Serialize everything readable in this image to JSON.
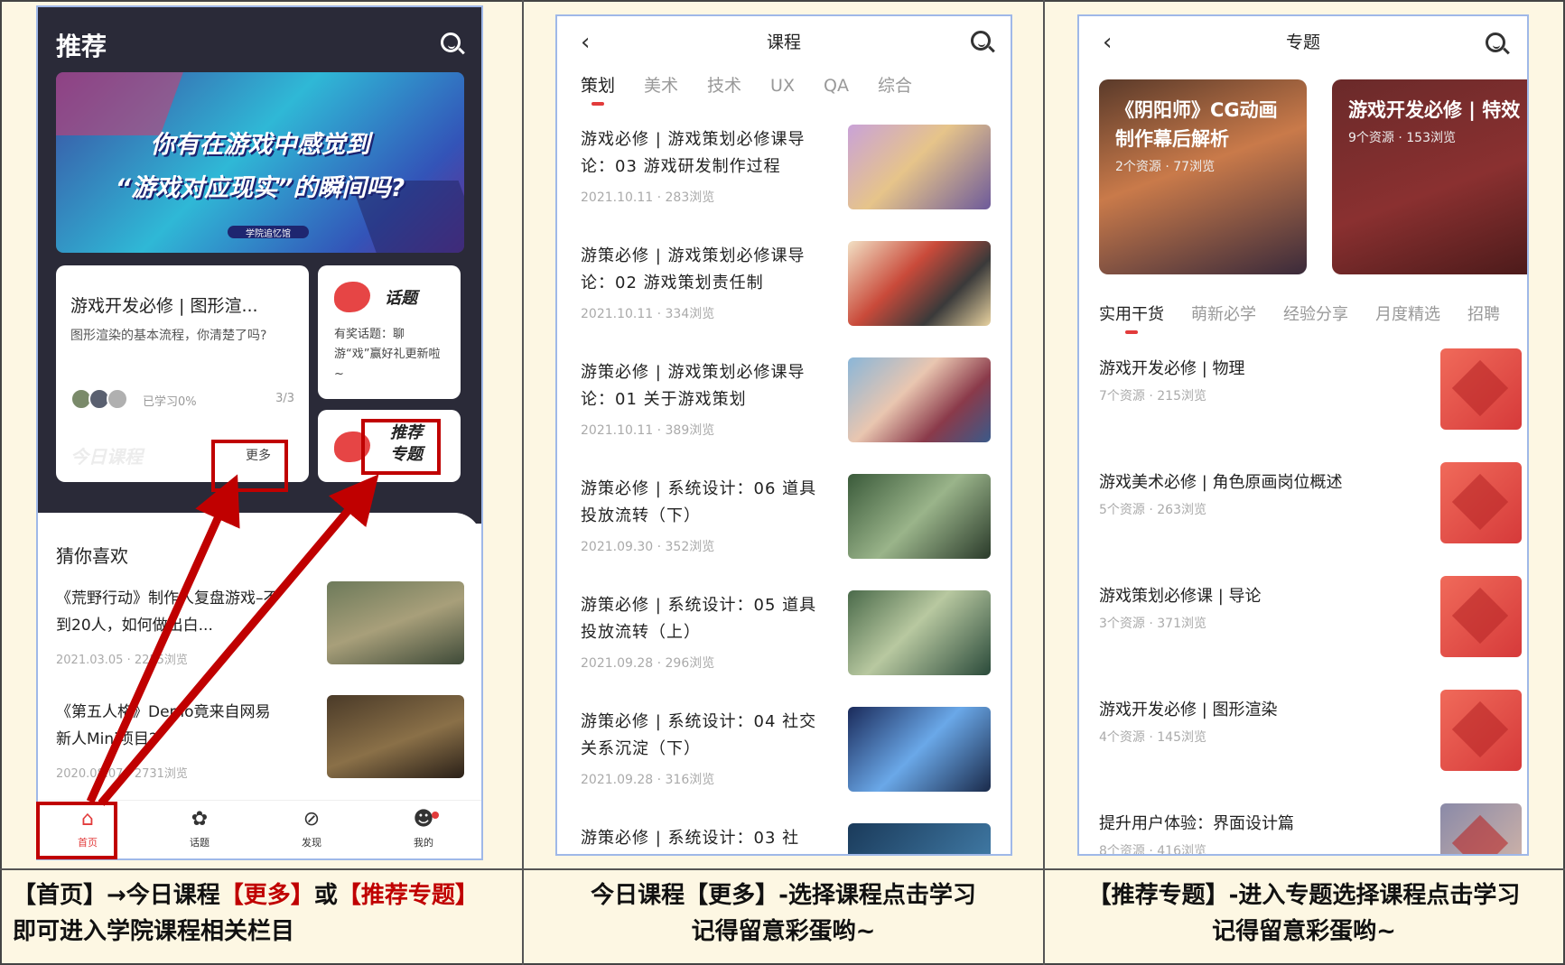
{
  "panel1": {
    "title": "推荐",
    "banner": {
      "line1": "你有在游戏中感觉到",
      "line2": "“游戏对应现实”的瞬间吗?",
      "tag": "学院追忆馆"
    },
    "course_card": {
      "title": "游戏开发必修 | 图形渲...",
      "desc": "图形渲染的基本流程，你清楚了吗?",
      "progress": "已学习0%",
      "count": "3/3",
      "watermark": "今日课程",
      "more": "更多"
    },
    "topic_card": {
      "title": "话题",
      "desc": "有奖话题：聊游“戏”赢好礼更新啦~"
    },
    "rec_card": {
      "title": "推荐专题"
    },
    "guess_title": "猜你喜欢",
    "guess_items": [
      {
        "title": "《荒野行动》制作人复盘游戏–不到20人，如何做出白...",
        "meta": "2021.03.05 · 2255浏览"
      },
      {
        "title": "《第五人格》Demo竟来自网易新人Mini项目?",
        "meta": "2020.08.07 · 2731浏览"
      }
    ],
    "tabs": [
      {
        "label": "首页",
        "icon": "home-icon",
        "active": true
      },
      {
        "label": "话题",
        "icon": "topic-icon",
        "active": false
      },
      {
        "label": "发现",
        "icon": "compass-icon",
        "active": false
      },
      {
        "label": "我的",
        "icon": "face-icon",
        "active": false
      }
    ]
  },
  "panel2": {
    "title": "课程",
    "tabs": [
      "策划",
      "美术",
      "技术",
      "UX",
      "QA",
      "综合"
    ],
    "courses": [
      {
        "title": "游戏必修 | 游戏策划必修课导论：03 游戏研发制作过程",
        "meta": "2021.10.11 · 283浏览"
      },
      {
        "title": "游策必修 | 游戏策划必修课导论：02 游戏策划责任制",
        "meta": "2021.10.11 · 334浏览"
      },
      {
        "title": "游策必修 | 游戏策划必修课导论：01 关于游戏策划",
        "meta": "2021.10.11 · 389浏览"
      },
      {
        "title": "游策必修 | 系统设计：06 道具投放流转（下）",
        "meta": "2021.09.30 · 352浏览"
      },
      {
        "title": "游策必修 | 系统设计：05 道具投放流转（上）",
        "meta": "2021.09.28 · 296浏览"
      },
      {
        "title": "游策必修 | 系统设计：04 社交关系沉淀（下）",
        "meta": "2021.09.28 · 316浏览"
      },
      {
        "title": "游策必修 | 系统设计：03 社",
        "meta": ""
      }
    ]
  },
  "panel3": {
    "title": "专题",
    "featured": [
      {
        "title": "《阴阳师》CG动画制作幕后解析",
        "meta": "2个资源 · 77浏览"
      },
      {
        "title": "游戏开发必修 | 特效",
        "meta": "9个资源 · 153浏览"
      }
    ],
    "tabs": [
      "实用干货",
      "萌新必学",
      "经验分享",
      "月度精选",
      "招聘"
    ],
    "topics": [
      {
        "title": "游戏开发必修 | 物理",
        "meta": "7个资源 · 215浏览"
      },
      {
        "title": "游戏美术必修 | 角色原画岗位概述",
        "meta": "5个资源 · 263浏览"
      },
      {
        "title": "游戏策划必修课 | 导论",
        "meta": "3个资源 · 371浏览"
      },
      {
        "title": "游戏开发必修 | 图形渲染",
        "meta": "4个资源 · 145浏览"
      },
      {
        "title": "提升用户体验：界面设计篇",
        "meta": "8个资源 · 416浏览"
      }
    ]
  },
  "captions": {
    "c1_a": "【首页】→今日课程",
    "c1_b": "【更多】",
    "c1_c": "或",
    "c1_d": "【推荐专题】",
    "c1_line2": "即可进入学院课程相关栏目",
    "c2_line1": "今日课程【更多】-选择课程点击学习",
    "c2_line2": "记得留意彩蛋哟~",
    "c3_line1": "【推荐专题】-进入专题选择课程点击学习",
    "c3_line2": "记得留意彩蛋哟~"
  },
  "colors": {
    "accent": "#e23b3b",
    "highlight": "#c00000",
    "background": "#fdf7e3"
  }
}
